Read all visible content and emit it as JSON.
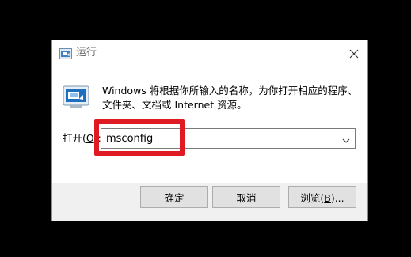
{
  "window": {
    "title": "运行",
    "title_icon": "run-icon",
    "close_icon": "close-icon"
  },
  "description": {
    "line1": "Windows 将根据你所输入的名称，为你打开相应的程序、",
    "line2": "文件夹、文档或 Internet 资源。"
  },
  "open_field": {
    "label_before": "打开(",
    "label_accel": "O",
    "label_after": "):",
    "value": "msconfig",
    "dropdown_icon": "chevron-down-icon"
  },
  "buttons": {
    "ok_label": "确定",
    "cancel_label": "取消",
    "browse_before": "浏览(",
    "browse_accel": "B",
    "browse_after": ")..."
  },
  "colors": {
    "highlight": "#e01a22",
    "background": "#000000",
    "dialog": "#f0f0f0",
    "button": "#e1e1e1"
  }
}
